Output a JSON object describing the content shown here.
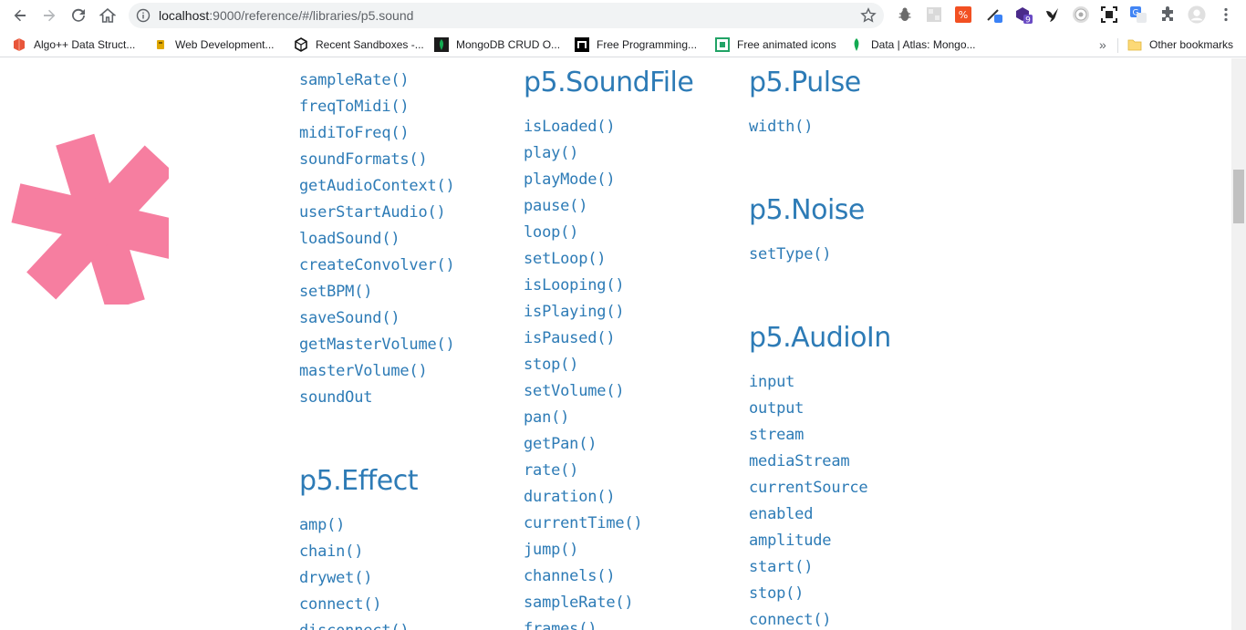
{
  "browser": {
    "url_host": "localhost",
    "url_rest": ":9000/reference/#/libraries/p5.sound",
    "extension_badge": "9"
  },
  "bookmarks": {
    "items": [
      {
        "label": "Algo++ Data Struct...",
        "icon": "algo-icon",
        "color": "#e8553a"
      },
      {
        "label": "Web Development...",
        "icon": "web-dev-icon",
        "color": "#e0a800"
      },
      {
        "label": "Recent Sandboxes -...",
        "icon": "codesandbox-icon",
        "color": "#151515"
      },
      {
        "label": "MongoDB CRUD O...",
        "icon": "mongodb-icon",
        "color": "#13aa52"
      },
      {
        "label": "Free Programming...",
        "icon": "freeprog-icon",
        "color": "#000000"
      },
      {
        "label": "Free animated icons",
        "icon": "lordicon-icon",
        "color": "#21a366"
      },
      {
        "label": "Data | Atlas: Mongo...",
        "icon": "leaf-icon",
        "color": "#13aa52"
      }
    ],
    "overflow": "»",
    "other": "Other bookmarks"
  },
  "sections": {
    "sound_funcs": {
      "items": [
        "sampleRate()",
        "freqToMidi()",
        "midiToFreq()",
        "soundFormats()",
        "getAudioContext()",
        "userStartAudio()",
        "loadSound()",
        "createConvolver()",
        "setBPM()",
        "saveSound()",
        "getMasterVolume()",
        "masterVolume()",
        "soundOut"
      ]
    },
    "effect": {
      "title": "p5.Effect",
      "items": [
        "amp()",
        "chain()",
        "drywet()",
        "connect()",
        "disconnect()"
      ]
    },
    "soundfile": {
      "title": "p5.SoundFile",
      "items": [
        "isLoaded()",
        "play()",
        "playMode()",
        "pause()",
        "loop()",
        "setLoop()",
        "isLooping()",
        "isPlaying()",
        "isPaused()",
        "stop()",
        "setVolume()",
        "pan()",
        "getPan()",
        "rate()",
        "duration()",
        "currentTime()",
        "jump()",
        "channels()",
        "sampleRate()",
        "frames()"
      ]
    },
    "pulse": {
      "title": "p5.Pulse",
      "items": [
        "width()"
      ]
    },
    "noise": {
      "title": "p5.Noise",
      "items": [
        "setType()"
      ]
    },
    "audioin": {
      "title": "p5.AudioIn",
      "items": [
        "input",
        "output",
        "stream",
        "mediaStream",
        "currentSource",
        "enabled",
        "amplitude",
        "start()",
        "stop()",
        "connect()"
      ]
    }
  },
  "colors": {
    "link": "#2d7bb6",
    "asterisk": "#f67ea0"
  }
}
